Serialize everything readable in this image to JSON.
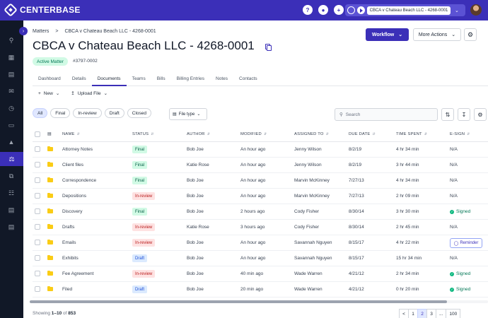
{
  "app": {
    "brand": "CENTERBASE"
  },
  "topbar": {
    "help_icon": "question-icon",
    "notif_icon": "bell-icon",
    "add_icon": "plus-icon",
    "timer_matter": "CBCA v Chateau Beach LLC - 4268-0001"
  },
  "sidebar": {
    "icons": [
      "search-icon",
      "dashboard-icon",
      "calendar-icon",
      "mail-icon",
      "clock-icon",
      "folder-icon",
      "reports-icon",
      "matters-icon",
      "copy-icon",
      "contacts-icon",
      "billing-icon",
      "documents-icon"
    ],
    "active": "matters-icon"
  },
  "breadcrumb": {
    "root": "Matters",
    "separator": ">",
    "current": "CBCA v Chateau Beach LLC - 4268-0001"
  },
  "header": {
    "title": "CBCA v Chateau Beach LLC - 4268-0001",
    "status": "Active Matter",
    "matter_id": "#3797-0002",
    "workflow_label": "Workflow",
    "more_actions_label": "More Actions"
  },
  "tabs": [
    "Dashboard",
    "Details",
    "Documents",
    "Teams",
    "Bills",
    "Billing Entries",
    "Notes",
    "Contacts"
  ],
  "active_tab": "Documents",
  "toolbar": {
    "new_label": "New",
    "upload_label": "Upload File"
  },
  "filters": {
    "pills": [
      "All",
      "Final",
      "In-review",
      "Draft",
      "Closed"
    ],
    "active": "All",
    "file_type_label": "File type",
    "search_placeholder": "Search"
  },
  "table": {
    "columns": [
      "NAME",
      "STATUS",
      "AUTHOR",
      "MODIFIED",
      "ASSIGNED TO",
      "DUE DATE",
      "TIME SPENT",
      "E-SIGN"
    ],
    "rows": [
      {
        "name": "Attorney Notes",
        "status": "Final",
        "author": "Bob Joe",
        "modified": "An hour ago",
        "assigned": "Jenny Wilson",
        "due": "8/2/19",
        "time": "4 hr 34 min",
        "esign": "N/A"
      },
      {
        "name": "Client files",
        "status": "Final",
        "author": "Katie Rose",
        "modified": "An hour ago",
        "assigned": "Jenny Wilson",
        "due": "8/2/19",
        "time": "3 hr 44 min",
        "esign": "N/A"
      },
      {
        "name": "Correspondence",
        "status": "Final",
        "author": "Bob Joe",
        "modified": "An hour ago",
        "assigned": "Marvin McKinney",
        "due": "7/27/13",
        "time": "4 hr 34 min",
        "esign": "N/A"
      },
      {
        "name": "Depositions",
        "status": "In-review",
        "author": "Bob Joe",
        "modified": "An hour ago",
        "assigned": "Marvin McKinney",
        "due": "7/27/13",
        "time": "2 hr 09 min",
        "esign": "N/A"
      },
      {
        "name": "Discovery",
        "status": "Final",
        "author": "Bob Joe",
        "modified": "2 hours ago",
        "assigned": "Cody Fisher",
        "due": "8/30/14",
        "time": "3 hr 30 min",
        "esign": "Signed"
      },
      {
        "name": "Drafts",
        "status": "In-review",
        "author": "Katie Rose",
        "modified": "3 hours ago",
        "assigned": "Cody Fisher",
        "due": "8/30/14",
        "time": "2 hr 45 min",
        "esign": "N/A"
      },
      {
        "name": "Emails",
        "status": "In-review",
        "author": "Bob Joe",
        "modified": "An hour ago",
        "assigned": "Savannah Nguyen",
        "due": "8/15/17",
        "time": "4 hr 22 min",
        "esign": "Reminder"
      },
      {
        "name": "Exhibits",
        "status": "Draft",
        "author": "Bob Joe",
        "modified": "An hour ago",
        "assigned": "Savannah Nguyen",
        "due": "8/15/17",
        "time": "15 hr 34 min",
        "esign": "N/A"
      },
      {
        "name": "Fee Agreement",
        "status": "In-review",
        "author": "Bob Joe",
        "modified": "40 min ago",
        "assigned": "Wade Warren",
        "due": "4/21/12",
        "time": "2 hr 34 min",
        "esign": "Signed"
      },
      {
        "name": "Filed",
        "status": "Draft",
        "author": "Bob Joe",
        "modified": "20 min ago",
        "assigned": "Wade Warren",
        "due": "4/21/12",
        "time": "0 hr 20 min",
        "esign": "Signed"
      }
    ]
  },
  "footer": {
    "showing_prefix": "Showing",
    "range": "1–10",
    "of_word": "of",
    "total": "853",
    "pages": [
      "<",
      "1",
      "2",
      "3",
      "...",
      "100"
    ],
    "current_page": "2"
  }
}
